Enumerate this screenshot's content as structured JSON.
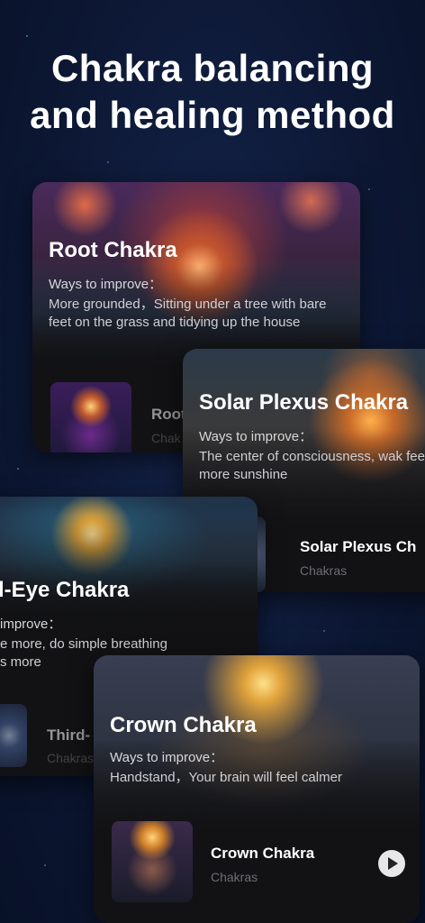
{
  "headline": {
    "line1": "Chakra balancing",
    "line2": "and healing method"
  },
  "cards": [
    {
      "title": "Root Chakra",
      "ways_label": "Ways to improve：",
      "description": "More grounded，Sitting under a tree with bare feet on the grass and tidying up the house",
      "track_title": "Root",
      "track_category": "Chak"
    },
    {
      "title": "Solar Plexus Chakra",
      "ways_label": "Ways to improve：",
      "description": "The center of consciousness, wak feel more sunshine",
      "track_title": "Solar Plexus Ch",
      "track_category": "Chakras"
    },
    {
      "title": "l-Eye Chakra",
      "ways_label": "improve：",
      "description_line1": "e more, do simple breathing",
      "description_line2": "s more",
      "track_title": "Third-",
      "track_category": "Chakras"
    },
    {
      "title": "Crown Chakra",
      "ways_label": "Ways to improve：",
      "description": "Handstand，Your brain will feel calmer",
      "track_title": "Crown Chakra",
      "track_category": "Chakras"
    }
  ],
  "icons": {
    "play": "play-icon"
  }
}
